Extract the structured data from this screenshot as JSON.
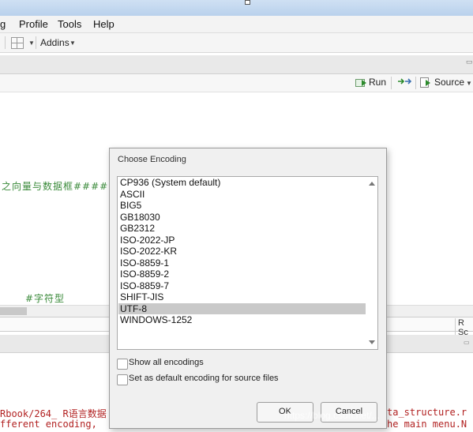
{
  "menu": [
    "g",
    "Profile",
    "Tools",
    "Help"
  ],
  "toolbar": {
    "addins_label": "Addins"
  },
  "editor_toolbar": {
    "run_label": "Run",
    "source_label": "Source"
  },
  "editor_code": {
    "line1": "之向量与数据框####",
    "line2": "#字符型"
  },
  "status": {
    "file_type": "R Sc"
  },
  "console": {
    "line1_left": "Rbook/264_ R语言数据",
    "line1_right": "ta_structure.r",
    "line2_left": "fferent encoding,",
    "line2_right": "he main menu.N"
  },
  "watermark": "https://blog.csdn.net/...",
  "dialog": {
    "title": "Choose Encoding",
    "encodings": [
      "CP936 (System default)",
      "ASCII",
      "BIG5",
      "GB18030",
      "GB2312",
      "ISO-2022-JP",
      "ISO-2022-KR",
      "ISO-8859-1",
      "ISO-8859-2",
      "ISO-8859-7",
      "SHIFT-JIS",
      "UTF-8",
      "WINDOWS-1252"
    ],
    "selected": "UTF-8",
    "show_all_label": "Show all encodings",
    "set_default_label": "Set as default encoding for source files",
    "ok_label": "OK",
    "cancel_label": "Cancel"
  }
}
